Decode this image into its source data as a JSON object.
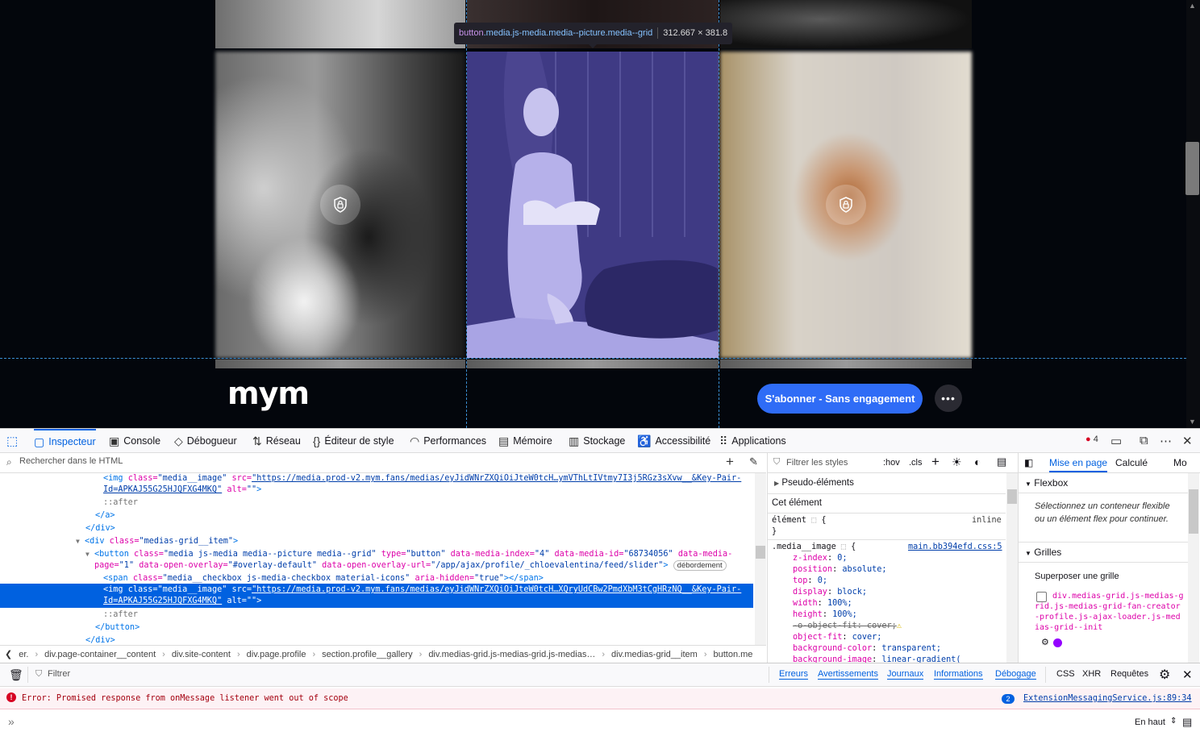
{
  "webpage": {
    "highlight_tooltip": {
      "tag": "button",
      "classes": ".media.js-media.media--picture.media--grid",
      "size": "312.667 × 381.8"
    },
    "logo": "mym",
    "subscribe_label": "S'abonner - Sans engagement",
    "more_label": "•••"
  },
  "devtools": {
    "tabs": [
      {
        "label": "Inspecteur",
        "icon": "inspector-icon"
      },
      {
        "label": "Console",
        "icon": "console-icon"
      },
      {
        "label": "Débogueur",
        "icon": "debugger-icon"
      },
      {
        "label": "Réseau",
        "icon": "network-icon"
      },
      {
        "label": "Éditeur de style",
        "icon": "style-editor-icon"
      },
      {
        "label": "Performances",
        "icon": "performance-icon"
      },
      {
        "label": "Mémoire",
        "icon": "memory-icon"
      },
      {
        "label": "Stockage",
        "icon": "storage-icon"
      },
      {
        "label": "Accessibilité",
        "icon": "accessibility-icon"
      },
      {
        "label": "Applications",
        "icon": "applications-icon"
      }
    ],
    "error_count": "4",
    "html_search_placeholder": "Rechercher dans le HTML",
    "markup": {
      "l1_tag": "<img",
      "l1_class_attr": "class=",
      "l1_class_val": "\"media__image\"",
      "l1_src_attr": "src=",
      "l1_src_val": "\"https://media.prod-v2.mym.fans/medias/eyJidWNrZXQiOiJteW0tcH…ymVThLtIVtmy7I3j5RGz3sXvw__&Key-Pair-",
      "l1b_src_val": "Id=APKAJ55G25HJQFXG4MKQ\"",
      "l1b_alt": "alt=",
      "l1b_alt_val": "\"\"",
      "l1b_end": ">",
      "after1": "::after",
      "close_a": "</a>",
      "close_div": "</div>",
      "div_open": "<div",
      "div_class_attr": "class=",
      "div_class_val": "\"medias-grid__item\"",
      "div_end": ">",
      "button_open": "<button",
      "button_class_attr": "class=",
      "button_class_val": "\"media js-media media--picture media--grid\"",
      "button_type_attr": "type=",
      "button_type_val": "\"button\"",
      "button_idx_attr": "data-media-index=",
      "button_idx_val": "\"4\"",
      "button_id_attr": "data-media-id=",
      "button_id_val": "\"68734056\"",
      "button_mp_attr": "data-media-",
      "button2_page_attr": "page=",
      "button2_page_val": "\"1\"",
      "button2_ov_attr": "data-open-overlay=",
      "button2_ov_val": "\"#overlay-default\"",
      "button2_url_attr": "data-open-overlay-url=",
      "button2_url_val": "\"/app/ajax/profile/_chloevalentina/feed/slider\"",
      "button2_end": ">",
      "button2_badge": "débordement",
      "span_open": "<span",
      "span_class_attr": "class=",
      "span_class_val": "\"media__checkbox js-media-checkbox material-icons\"",
      "span_aria_attr": "aria-hidden=",
      "span_aria_val": "\"true\"",
      "span_close": "></span>",
      "sel_tag": "<img",
      "sel_class_attr": "class=",
      "sel_class_val": "\"media__image\"",
      "sel_src_attr": "src=",
      "sel_src_val": "\"https://media.prod-v2.mym.fans/medias/eyJidWNrZXQiOiJteW0tcH…XQryUdCBw2PmdXbM3tCgHRzNQ__&Key-Pair-",
      "sel2_src_val": "Id=APKAJ55G25HJQFXG4MKQ\"",
      "sel2_alt": "alt=",
      "sel2_alt_val": "\"\"",
      "sel2_end": ">",
      "after2": "::after",
      "close_button": "</button>",
      "close_div2": "</div>"
    },
    "breadcrumb": [
      "er.",
      "div.page-container__content",
      "div.site-content",
      "div.page.profile",
      "section.profile__gallery",
      "div.medias-grid.js-medias-grid.js-medias…",
      "div.medias-grid__item",
      "button.me"
    ],
    "rules": {
      "filter_placeholder": "Filtrer les styles",
      "hov": ":hov",
      "cls": ".cls",
      "pseudo_elements": "Pseudo-éléments",
      "this_element": "Cet élément",
      "element_selector": "élément",
      "element_open": "{",
      "inline": "inline",
      "close": "}",
      "selector": ".media__image",
      "selector_open": "{",
      "source": "main.bb394efd.css:5",
      "props": [
        {
          "name": "z-index",
          "value": "0;"
        },
        {
          "name": "position",
          "value": "absolute;"
        },
        {
          "name": "top",
          "value": "0;"
        },
        {
          "name": "display",
          "value": "block;"
        },
        {
          "name": "width",
          "value": "100%;"
        },
        {
          "name": "height",
          "value": "100%;"
        },
        {
          "name": "-o-object-fit",
          "value": "cover;"
        },
        {
          "name": "object-fit",
          "value": "cover;"
        },
        {
          "name": "background-color",
          "value": "transparent;"
        },
        {
          "name": "background-image",
          "value": "linear-gradient("
        }
      ]
    },
    "layout": {
      "tabs": [
        "Mise en page",
        "Calculé",
        "Mo"
      ],
      "flexbox_title": "Flexbox",
      "flexbox_text": "Sélectionnez un conteneur flexible ou un élément flex pour continuer.",
      "grids_title": "Grilles",
      "overlay_label": "Superposer une grille",
      "grid_item": "div.medias-grid.js-medias-grid.js-medias-grid-fan-creator-profile.js-ajax-loader.js-medias-grid--init"
    },
    "console": {
      "filter_placeholder": "Filtrer",
      "levels": [
        "Erreurs",
        "Avertissements",
        "Journaux",
        "Informations",
        "Débogage"
      ],
      "extra": [
        "CSS",
        "XHR",
        "Requêtes"
      ],
      "error_message": "Error: Promised response from onMessage listener went out of scope",
      "error_repeat": "2",
      "error_source": "ExtensionMessagingService.js:89:34",
      "position_label": "En haut"
    }
  },
  "colors": {
    "accent": "#0061e0",
    "subscribe": "#2f6cf6",
    "highlight": "#8d87d6"
  }
}
